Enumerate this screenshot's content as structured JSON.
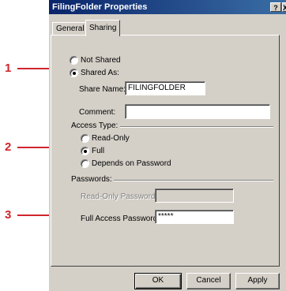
{
  "window": {
    "title": "FilingFolder Properties",
    "help_glyph": "?",
    "close_glyph": "X"
  },
  "tabs": [
    {
      "label": "General"
    },
    {
      "label": "Sharing"
    }
  ],
  "sharing": {
    "not_shared_label": "Not Shared",
    "shared_as_label": "Shared As:",
    "share_name_label": "Share Name:",
    "share_name_value": "FILINGFOLDER",
    "comment_label": "Comment:",
    "comment_value": ""
  },
  "access_type": {
    "heading": "Access Type:",
    "options": [
      "Read-Only",
      "Full",
      "Depends on Password"
    ],
    "selected": "Full"
  },
  "passwords": {
    "heading": "Passwords:",
    "read_only_label": "Read-Only Password:",
    "read_only_value": "",
    "full_access_label": "Full Access Password:",
    "full_access_value": "*****"
  },
  "buttons": {
    "ok": "OK",
    "cancel": "Cancel",
    "apply": "Apply"
  },
  "callouts": [
    "1",
    "2",
    "3"
  ],
  "colors": {
    "callout": "#d0262c",
    "title_bar": "#0a246a",
    "face": "#d4d0c8"
  }
}
